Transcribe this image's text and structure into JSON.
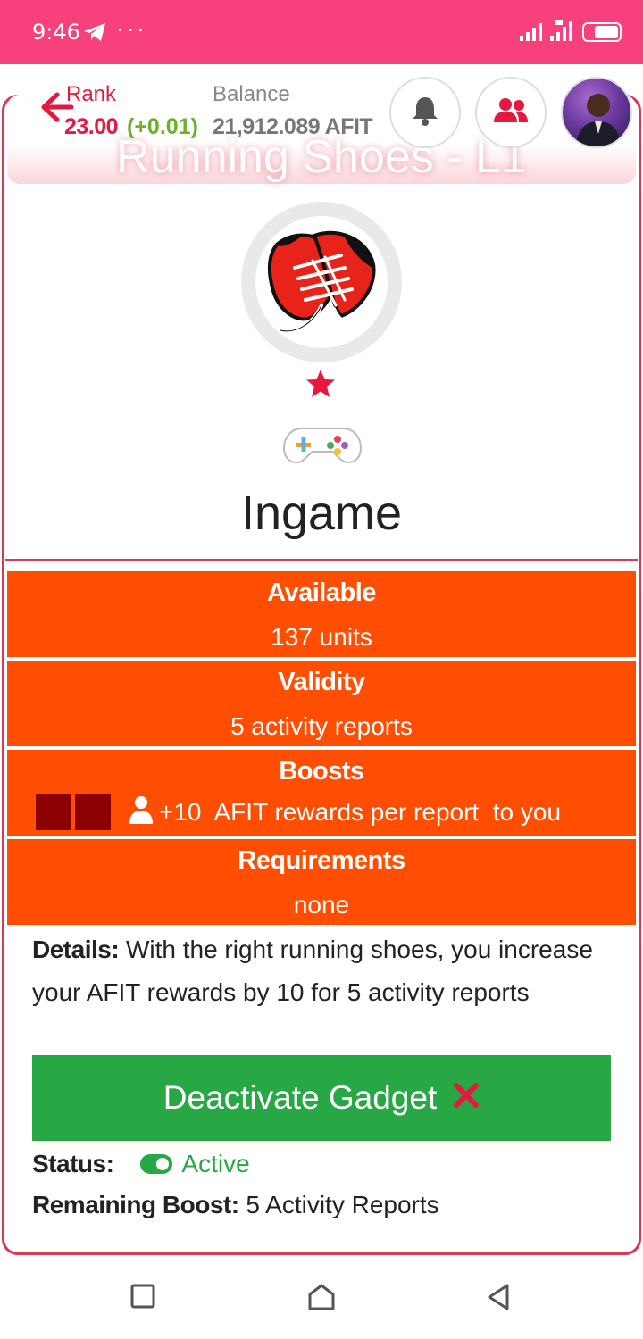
{
  "status_bar": {
    "time": "9:46",
    "overflow": "···",
    "icons": [
      "telegram-icon",
      "signal-icon",
      "signal-icon",
      "battery-icon"
    ]
  },
  "header": {
    "rank_label": "Rank",
    "rank_value": "23.00",
    "rank_delta": "(+0.01)",
    "balance_label": "Balance",
    "balance_value": "21,912.089 AFIT",
    "page_title": "Running Shoes - L1",
    "icons": [
      "back-arrow-icon",
      "bell-icon",
      "users-icon",
      "avatar"
    ]
  },
  "gadget": {
    "category": "Ingame",
    "rarity_stars": 1
  },
  "info": {
    "available_title": "Available",
    "available_value": "137 units",
    "validity_title": "Validity",
    "validity_value": "5 activity reports",
    "boosts_title": "Boosts",
    "boosts_value": "+10  AFIT rewards per report  to you",
    "requirements_title": "Requirements",
    "requirements_value": "none"
  },
  "details": {
    "label": "Details:",
    "text": "With the right running shoes, you increase your AFIT rewards by 10 for 5 activity reports"
  },
  "action": {
    "deactivate_label": "Deactivate Gadget"
  },
  "status": {
    "label": "Status:",
    "value": "Active",
    "remaining_label": "Remaining Boost:",
    "remaining_value": "5 Activity Reports"
  },
  "colors": {
    "status_bar": "#f8417c",
    "accent_red": "#e5193f",
    "info_orange": "#ff4e02",
    "button_green": "#28a745",
    "boost_square": "#8b0000"
  }
}
